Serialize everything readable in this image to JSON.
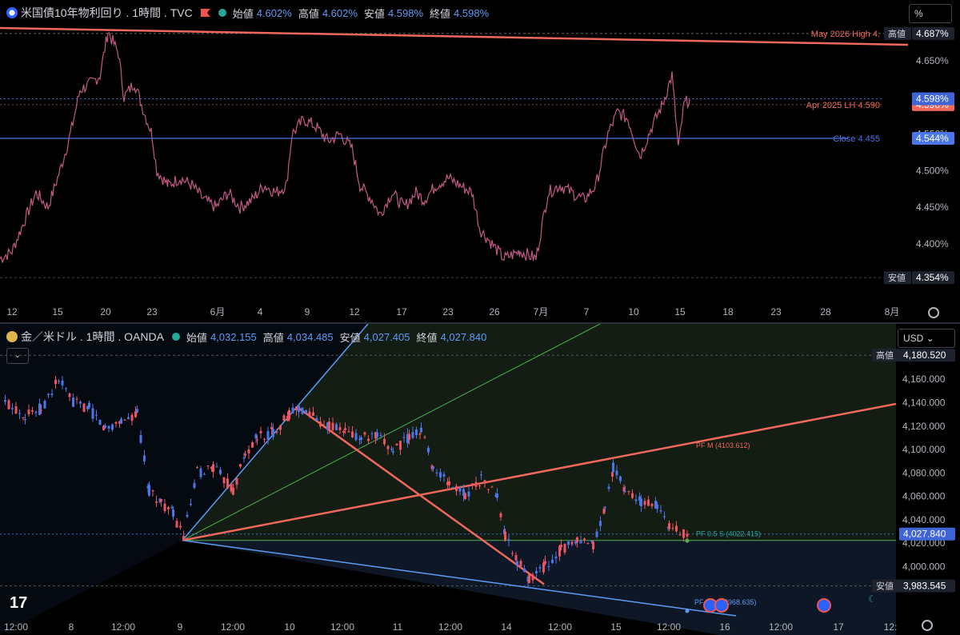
{
  "top": {
    "symbol": "米国債10年物利回り . 1時間 . TVC",
    "ohlc": [
      {
        "label": "始値",
        "value": "4.602%"
      },
      {
        "label": "高値",
        "value": "4.602%"
      },
      {
        "label": "安値",
        "value": "4.598%"
      },
      {
        "label": "終値",
        "value": "4.598%"
      }
    ],
    "unit": "%",
    "x_ticks": [
      "12",
      "15",
      "20",
      "23",
      "6月",
      "4",
      "9",
      "12",
      "17",
      "23",
      "26",
      "7月",
      "7",
      "10",
      "15",
      "18",
      "23",
      "28",
      "8月"
    ],
    "y_ticks": [
      "4.650%",
      "4.550%",
      "4.500%",
      "4.450%",
      "4.400%"
    ],
    "y_range": [
      4.34,
      4.7
    ],
    "lines": [
      {
        "label": "May 2026 High 4.",
        "tag": "高値",
        "value": "4.687%",
        "price": 4.687,
        "color": "#f0685c"
      },
      {
        "label": "Apr 2025 LH 4.590",
        "tag": "",
        "value": "4.590%",
        "price": 4.59,
        "color": "#f0685c"
      },
      {
        "label": "Close 4.455",
        "tag": "",
        "value": "4.544%",
        "price": 4.544,
        "color": "#4a76e8"
      },
      {
        "label": "",
        "tag": "",
        "value": "4.598%",
        "price": 4.598,
        "color": "#3e64d6"
      },
      {
        "label": "",
        "tag": "安値",
        "value": "4.354%",
        "price": 4.354,
        "color": "#555"
      }
    ]
  },
  "bottom": {
    "symbol": "金／米ドル . 1時間 . OANDA",
    "ohlc": [
      {
        "label": "始値",
        "value": "4,032.155"
      },
      {
        "label": "高値",
        "value": "4,034.485"
      },
      {
        "label": "安値",
        "value": "4,027.405"
      },
      {
        "label": "終値",
        "value": "4,027.840"
      }
    ],
    "unit": "USD",
    "x_ticks": [
      "12:00",
      "8",
      "12:00",
      "9",
      "12:00",
      "10",
      "12:00",
      "11",
      "12:00",
      "14",
      "12:00",
      "15",
      "12:00",
      "16",
      "12:00",
      "17",
      "12:"
    ],
    "y_ticks": [
      "4,160.000",
      "4,140.000",
      "4,120.000",
      "4,100.000",
      "4,080.000",
      "4,060.000",
      "4,040.000",
      "4,020.000",
      "4,000.000"
    ],
    "y_range": [
      3,
      958,
      4,
      195
    ],
    "tags": [
      {
        "tag": "高値",
        "value": "4,180.520",
        "price": 4180.52
      },
      {
        "tag": "",
        "value": "4,027.840",
        "price": 4027.84
      },
      {
        "tag": "安値",
        "value": "3,983.545",
        "price": 3983.545
      }
    ],
    "annotations": [
      {
        "text": "PF M (4103.612)",
        "color": "#f0685c"
      },
      {
        "text": "PF 0.5 S (4022.415)",
        "color": "#26a69a"
      },
      {
        "text": "PF ",
        "color": "#5b9cf6"
      },
      {
        "text": "3968.635)",
        "color": "#5b9cf6"
      }
    ]
  },
  "chart_data": [
    {
      "type": "line",
      "title": "米国債10年物利回り . 1時間 . TVC",
      "ylim": [
        4.34,
        4.7
      ],
      "x": [
        "12",
        "15",
        "20",
        "23",
        "6月",
        "4",
        "9",
        "12",
        "17",
        "23",
        "26",
        "7月",
        "7",
        "10",
        "15"
      ],
      "series": [
        {
          "values": [
            4.38,
            4.44,
            4.68,
            4.56,
            4.47,
            4.45,
            4.57,
            4.53,
            4.45,
            4.48,
            4.39,
            4.38,
            4.49,
            4.57,
            4.59
          ]
        }
      ]
    },
    {
      "type": "line",
      "title": "金／米ドル . 1時間 . OANDA",
      "ylim": [
        3958,
        4195
      ],
      "x": [
        "8",
        "9",
        "10",
        "11",
        "14",
        "15"
      ],
      "series": [
        {
          "values": [
            4150,
            4025,
            4135,
            4110,
            3985,
            4028
          ]
        }
      ]
    }
  ]
}
